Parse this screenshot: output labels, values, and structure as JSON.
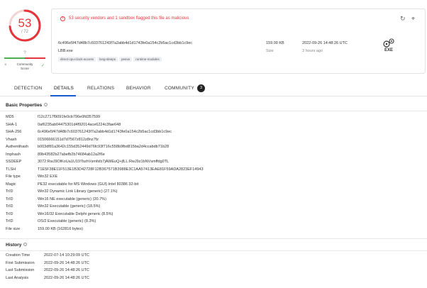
{
  "score": {
    "value": "53",
    "total": "/ 72",
    "question": "?",
    "community_label": "Community\nScore",
    "x": "×",
    "check": "✓"
  },
  "summary": {
    "flag_text": "53 security vendors and 1 sandbox flagged this file as malicious",
    "hash": "6c496e5f47d48b7c603761243f7a2abb4d1d1743fe0a154c2b5ac1cd3bb1c9ec",
    "filename": "LBB.exe",
    "tags": [
      "direct-cpu-clock-access",
      "long-sleeps",
      "peexe",
      "runtime-modules"
    ],
    "size_value": "159.00 KB",
    "size_label": "Size",
    "date_value": "2022-09-26 14:48:26 UTC",
    "date_label": "3 hours ago",
    "filetype": "EXE"
  },
  "tabs": [
    {
      "label": "DETECTION"
    },
    {
      "label": "DETAILS"
    },
    {
      "label": "RELATIONS"
    },
    {
      "label": "BEHAVIOR"
    },
    {
      "label": "COMMUNITY"
    }
  ],
  "community_count": "3",
  "basic": {
    "title": "Basic Properties",
    "rows": [
      {
        "k": "MD5",
        "v": "f12c2717f9091fe0cb796e0fd357599"
      },
      {
        "k": "SHA-1",
        "v": "0af6235ab04475301d4f92014ace6224c3fae648"
      },
      {
        "k": "SHA-256",
        "v": "6c496e5f47d48b7c603761243f7a2abb4d1d1743fe0a154c2b5ac1cd3bb1c9ec"
      },
      {
        "k": "Vhash",
        "v": "01506666151d7d7567z812z8nz7fz"
      },
      {
        "k": "Authentihash",
        "v": "b003df81a3642c155d352449d76fc93f716c558b9fbd815ba2d4ccabdb71b28"
      },
      {
        "k": "Imphash",
        "v": "89b43582b27abefb2b74684ab12a2f6e"
      },
      {
        "k": "SSDEEP",
        "v": "3072:RwJ9OlKoUa1U197bzhVsmfsfz7jAWEuQ+jfLL:RwJ9z1bNVsmffdg0TL"
      },
      {
        "k": "TLSH",
        "v": "T1E5F38E11F513E1B3D42728F12B367571B3988E3C1AA57413EAE81F59ADA2823EF14943"
      },
      {
        "k": "File type",
        "v": "Win32 EXE"
      },
      {
        "k": "Magic",
        "v": "PE32 executable for MS Windows (GUI) Intel 80386 32-bit"
      },
      {
        "k": "TrID",
        "v": "Win32 Dynamic Link Library (generic) (27.1%)"
      },
      {
        "k": "TrID",
        "v": "Win16 NE executable (generic) (20.7%)"
      },
      {
        "k": "TrID",
        "v": "Win32 Executable (generic) (18.5%)"
      },
      {
        "k": "TrID",
        "v": "Win16/32 Executable Delphi generic (8.5%)"
      },
      {
        "k": "TrID",
        "v": "OS/2 Executable (generic) (8.3%)"
      },
      {
        "k": "File size",
        "v": "159.00 KB (162816 bytes)"
      }
    ]
  },
  "history": {
    "title": "History",
    "rows": [
      {
        "k": "Creation Time",
        "v": "2022-07-14 10:29:09 UTC"
      },
      {
        "k": "First Submission",
        "v": "2022-09-26 14:48:26 UTC"
      },
      {
        "k": "Last Submission",
        "v": "2022-09-26 14:48:26 UTC"
      },
      {
        "k": "Last Analysis",
        "v": "2022-09-26 14:48:26 UTC"
      }
    ]
  },
  "colors": {
    "malicious": "#e5353b",
    "accent": "#1b59d1",
    "harmless": "#4caf50"
  }
}
